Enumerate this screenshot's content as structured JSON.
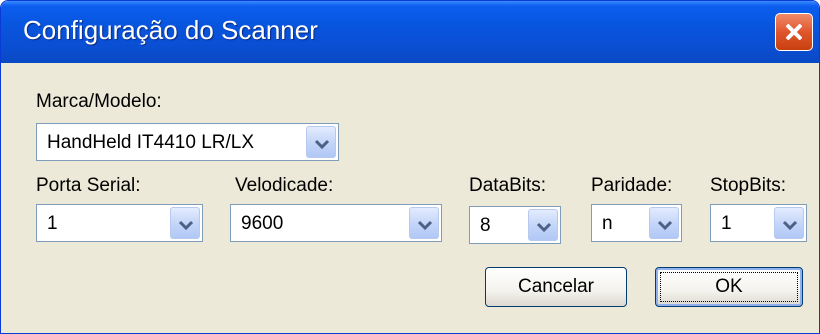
{
  "window": {
    "title": "Configuração do Scanner"
  },
  "fields": {
    "marca": {
      "label": "Marca/Modelo:",
      "value": "HandHeld IT4410 LR/LX"
    },
    "porta": {
      "label": "Porta Serial:",
      "value": "1"
    },
    "velocidade": {
      "label": "Velodicade:",
      "value": "9600"
    },
    "databits": {
      "label": "DataBits:",
      "value": "8"
    },
    "paridade": {
      "label": "Paridade:",
      "value": "n"
    },
    "stopbits": {
      "label": "StopBits:",
      "value": "1"
    }
  },
  "buttons": {
    "cancel": "Cancelar",
    "ok": "OK"
  },
  "icons": {
    "close": "close-icon",
    "dropdown": "chevron-down-icon"
  }
}
